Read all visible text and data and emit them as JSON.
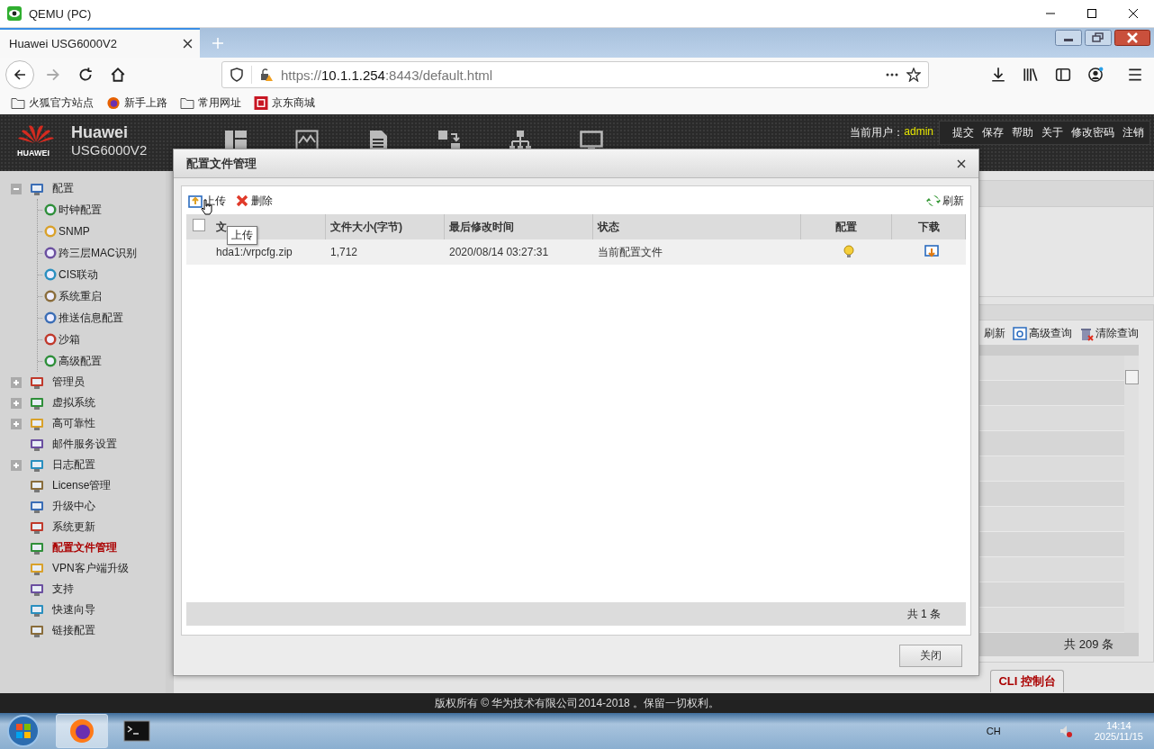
{
  "window": {
    "title": "QEMU (PC)"
  },
  "browser": {
    "tab": "Huawei USG6000V2",
    "url": {
      "scheme": "https://",
      "host": "10.1.1.254",
      "rest": ":8443/default.html"
    },
    "bookmarks": [
      {
        "label": "火狐官方站点",
        "kind": "folder"
      },
      {
        "label": "新手上路",
        "kind": "firefox"
      },
      {
        "label": "常用网址",
        "kind": "folder"
      },
      {
        "label": "京东商城",
        "kind": "jd"
      }
    ]
  },
  "header": {
    "brand": "Huawei",
    "model": "USG6000V2",
    "logo_text": "HUAWEI",
    "user_label": "当前用户：",
    "user": "admin",
    "links": [
      "提交",
      "保存",
      "帮助",
      "关于",
      "修改密码",
      "注销"
    ]
  },
  "sidebar": {
    "items": [
      {
        "label": "配置",
        "expanded": true,
        "selected": false,
        "children": [
          {
            "label": "时钟配置",
            "selected": false
          },
          {
            "label": "SNMP",
            "selected": false
          },
          {
            "label": "跨三层MAC识别",
            "selected": false
          },
          {
            "label": "CIS联动",
            "selected": false
          },
          {
            "label": "系统重启",
            "selected": false
          },
          {
            "label": "推送信息配置",
            "selected": false
          },
          {
            "label": "沙箱",
            "selected": false
          },
          {
            "label": "高级配置",
            "selected": false
          }
        ]
      },
      {
        "label": "管理员",
        "expanded": false,
        "selected": false
      },
      {
        "label": "虚拟系统",
        "expanded": false,
        "selected": false
      },
      {
        "label": "高可靠性",
        "expanded": false,
        "selected": false
      },
      {
        "label": "邮件服务设置",
        "selected": false
      },
      {
        "label": "日志配置",
        "expanded": false,
        "selected": false
      },
      {
        "label": "License管理",
        "selected": false
      },
      {
        "label": "升级中心",
        "selected": false
      },
      {
        "label": "系统更新",
        "selected": false
      },
      {
        "label": "配置文件管理",
        "selected": true
      },
      {
        "label": "VPN客户端升级",
        "selected": false
      },
      {
        "label": "支持",
        "selected": false
      },
      {
        "label": "快速向导",
        "selected": false
      },
      {
        "label": "链接配置",
        "selected": false
      }
    ]
  },
  "background_panel": {
    "toolbar": [
      "刷新",
      "高级查询",
      "清除查询"
    ],
    "total": "共 209 条",
    "cli_tab": "CLI 控制台"
  },
  "dialog": {
    "title": "配置文件管理",
    "toolbar": [
      {
        "label": "上传",
        "kind": "upload"
      },
      {
        "label": "删除",
        "kind": "delete"
      },
      {
        "label": "刷新",
        "kind": "refresh"
      }
    ],
    "tooltip": "上传",
    "table": {
      "select_all": {
        "checked": false
      },
      "columns": [
        "文",
        "文件大小(字节)",
        "最后修改时间",
        "状态",
        "配置",
        "下载"
      ],
      "rows": [
        {
          "file": "hda1:/vrpcfg.zip",
          "size": "1,712",
          "modified": "2020/08/14 03:27:31",
          "status": "当前配置文件"
        }
      ]
    },
    "total": "共 1 条",
    "close_button": "关闭"
  },
  "footer": "版权所有 © 华为技术有限公司2014-2018 。保留一切权利。",
  "taskbar": {
    "lang": "CH",
    "time": "14:14",
    "date": "2025/11/15"
  }
}
